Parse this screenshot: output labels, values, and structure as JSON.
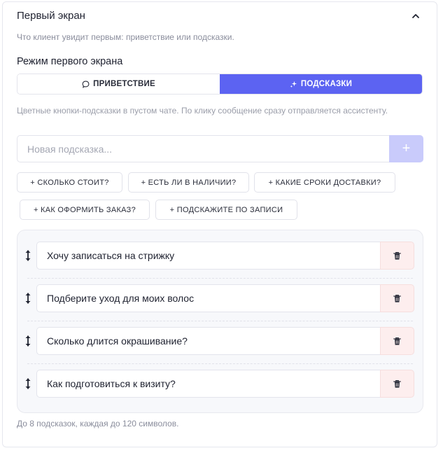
{
  "panel": {
    "title": "Первый экран",
    "subtitle": "Что клиент увидит первым: приветствие или подсказки."
  },
  "mode": {
    "label": "Режим первого экрана",
    "options": [
      {
        "label": "ПРИВЕТСТВИЕ",
        "icon": "chat-bubble-icon",
        "selected": false
      },
      {
        "label": "ПОДСКАЗКИ",
        "icon": "sparkles-icon",
        "selected": true
      }
    ]
  },
  "hints": {
    "description": "Цветные кнопки-подсказки в пустом чате. По клику сообщение сразу отправляется ассистенту.",
    "input_placeholder": "Новая подсказка...",
    "add_label": "+",
    "presets": [
      "+ СКОЛЬКО СТОИТ?",
      "+ ЕСТЬ ЛИ В НАЛИЧИИ?",
      "+ КАКИЕ СРОКИ ДОСТАВКИ?",
      "+ КАК ОФОРМИТЬ ЗАКАЗ?",
      "+ ПОДСКАЖИТЕ ПО ЗАПИСИ"
    ],
    "items": [
      "Хочу записаться на стрижку",
      "Подберите уход для моих волос",
      "Сколько длится окрашивание?",
      "Как подготовиться к визиту?"
    ],
    "footer": "До 8 подсказок, каждая до 120 символов."
  },
  "colors": {
    "accent": "#5c63f2",
    "accent_light": "#c9cbfb",
    "danger_bg": "#fdeeee"
  }
}
